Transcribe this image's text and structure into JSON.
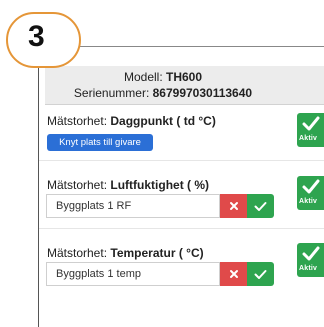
{
  "step": {
    "number": "3"
  },
  "device": {
    "model_label": "Modell:",
    "model_value": "TH600",
    "serial_label": "Serienummer:",
    "serial_value": "867997030113640"
  },
  "sensors": [
    {
      "prefix": "Mätstorhet:",
      "name": "Daggpunkt ( td °C)",
      "action_label": "Knyt plats till givare",
      "status": "Aktiv"
    },
    {
      "prefix": "Mätstorhet:",
      "name": "Luftfuktighet ( %)",
      "field_value": "Byggplats 1 RF",
      "status": "Aktiv"
    },
    {
      "prefix": "Mätstorhet:",
      "name": "Temperatur ( °C)",
      "field_value": "Byggplats 1 temp",
      "status": "Aktiv"
    }
  ],
  "icons": {
    "remove": "x-icon",
    "confirm": "check-icon",
    "status": "check-icon"
  },
  "colors": {
    "badge_border": "#e59638",
    "link_button": "#2b6fd6",
    "remove_button": "#e04a4a",
    "confirm_button": "#2ea44f",
    "status_active": "#2ea44f"
  }
}
